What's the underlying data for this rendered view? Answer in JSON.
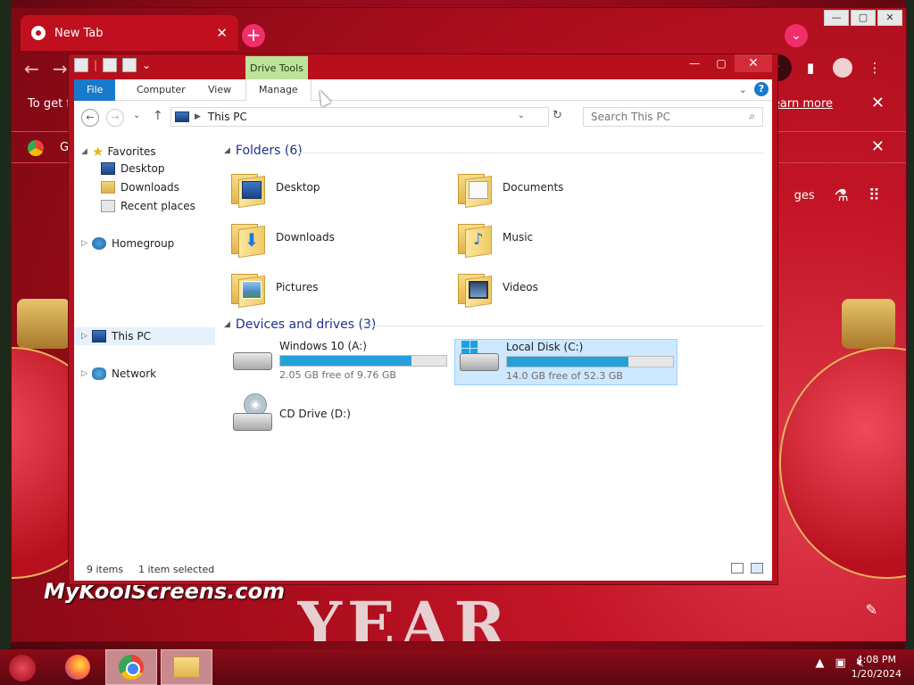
{
  "browser": {
    "tab_title": "New Tab",
    "tab_close": "✕",
    "new_tab": "+",
    "infobar_text": "To get fi",
    "learn_more": "Learn more",
    "info_close": "✕",
    "bookmark_letter": "G",
    "bookmark_close": "✕",
    "images_link": "ges"
  },
  "explorer": {
    "drive_tools_label": "Drive Tools",
    "ribbon_tabs": [
      "File",
      "Computer",
      "View",
      "Manage"
    ],
    "address": "This PC",
    "search_placeholder": "Search This PC",
    "nav": {
      "favorites": "Favorites",
      "desktop": "Desktop",
      "downloads": "Downloads",
      "recent": "Recent places",
      "homegroup": "Homegroup",
      "this_pc": "This PC",
      "network": "Network"
    },
    "folders_header": "Folders (6)",
    "folders": [
      "Desktop",
      "Documents",
      "Downloads",
      "Music",
      "Pictures",
      "Videos"
    ],
    "devices_header": "Devices and drives (3)",
    "drives": [
      {
        "name": "Windows 10 (A:)",
        "free": "2.05 GB free of 9.76 GB",
        "used_fraction": 0.79
      },
      {
        "name": "Local Disk (C:)",
        "free": "14.0 GB free of 52.3 GB",
        "used_fraction": 0.73
      },
      {
        "name": "CD Drive (D:)"
      }
    ],
    "status_count": "9 items",
    "status_selected": "1 item selected"
  },
  "watermark": "MyKoolScreens.com",
  "taskbar": {
    "time": "4:08 PM",
    "date": "1/20/2024"
  },
  "colors": {
    "accent_blue": "#1979ca",
    "bar_fill": "#26a0da",
    "header_blue": "#1e3287",
    "drive_tools_green": "#bde39a",
    "theme_red": "#b8101e"
  }
}
